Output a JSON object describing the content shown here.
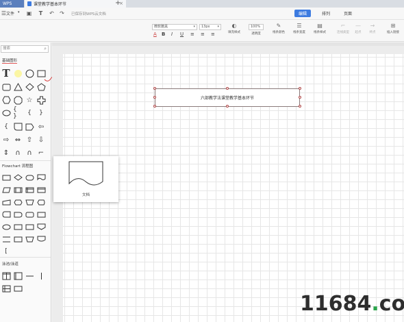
{
  "tabs": {
    "wps_label": "WPS",
    "doc_label": "课堂教学基本环节",
    "close_glyph": "×",
    "add_glyph": "+"
  },
  "menubar": {
    "file_label": "文件",
    "saved_text": "已保存到WPS云文档",
    "view_tabs": [
      {
        "label": "编辑",
        "active": true
      },
      {
        "label": "排列",
        "active": false
      },
      {
        "label": "页面",
        "active": false
      }
    ]
  },
  "toolbar": {
    "font_family_value": "微软雅黑",
    "font_size_value": "13px",
    "bold_label": "B",
    "italic_label": "I",
    "underline_label": "U",
    "font_color_label": "A",
    "zoom_value": "100%",
    "tools": [
      {
        "label": "填充样式",
        "icon": "fill-icon",
        "enabled": true
      },
      {
        "label": "透明度",
        "icon": "opacity-icon",
        "enabled": true
      },
      {
        "label": "线条颜色",
        "icon": "line-color-icon",
        "enabled": true
      },
      {
        "label": "线条宽度",
        "icon": "line-width-icon",
        "enabled": true
      },
      {
        "label": "线条样式",
        "icon": "line-style-icon",
        "enabled": true
      },
      {
        "label": "连线类型",
        "icon": "connector-type-icon",
        "enabled": false
      },
      {
        "label": "起点",
        "icon": "start-point-icon",
        "enabled": false
      },
      {
        "label": "终点",
        "icon": "end-point-icon",
        "enabled": false
      },
      {
        "label": "插入链接",
        "icon": "insert-link-icon",
        "enabled": true
      }
    ]
  },
  "panel": {
    "search_placeholder": "搜索",
    "sections": [
      {
        "title": "基础图形"
      },
      {
        "title": "Flowchart 流程图"
      },
      {
        "title": "泳池/泳道"
      }
    ]
  },
  "canvas": {
    "textbox_text": "六部教学法课堂教学基本环节",
    "popup_label": "文档"
  },
  "watermark": {
    "text_before": "11684",
    "dot": ".",
    "text_after": "com"
  },
  "colors": {
    "accent": "#3d7be0",
    "wps_tab": "#5b7fbd",
    "handle": "#b04848",
    "watermark_green": "#2aa34a"
  }
}
